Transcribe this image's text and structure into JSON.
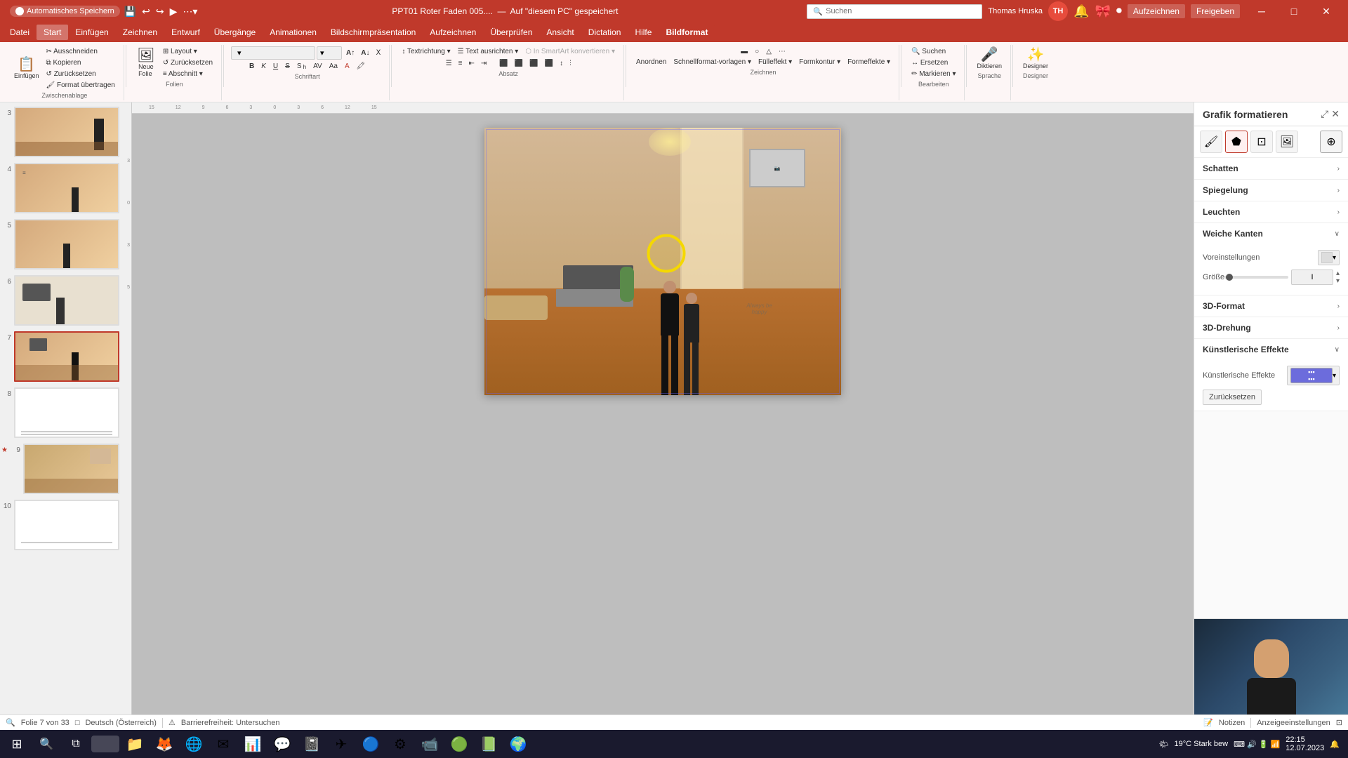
{
  "titleBar": {
    "autosave": "Automatisches Speichern",
    "title": "PPT01 Roter Faden 005....",
    "save_location": "Auf \"diesem PC\" gespeichert",
    "user": "Thomas Hruska",
    "user_initials": "TH",
    "min": "─",
    "max": "□",
    "close": "✕"
  },
  "search": {
    "placeholder": "Suchen"
  },
  "menuBar": {
    "items": [
      {
        "id": "datei",
        "label": "Datei"
      },
      {
        "id": "start",
        "label": "Start"
      },
      {
        "id": "einfuegen",
        "label": "Einfügen"
      },
      {
        "id": "zeichnen",
        "label": "Zeichnen"
      },
      {
        "id": "entwurf",
        "label": "Entwurf"
      },
      {
        "id": "uebergaenge",
        "label": "Übergänge"
      },
      {
        "id": "animationen",
        "label": "Animationen"
      },
      {
        "id": "bildschirmpraesentation",
        "label": "Bildschirmpräsentation"
      },
      {
        "id": "aufzeichnen",
        "label": "Aufzeichnen"
      },
      {
        "id": "ueberpruefen",
        "label": "Überprüfen"
      },
      {
        "id": "ansicht",
        "label": "Ansicht"
      },
      {
        "id": "dictation",
        "label": "Dictation"
      },
      {
        "id": "hilfe",
        "label": "Hilfe"
      },
      {
        "id": "bildformat",
        "label": "Bildformat"
      }
    ]
  },
  "ribbon": {
    "groups": [
      {
        "id": "zwischenablage",
        "label": "Zwischenablage",
        "buttons": [
          {
            "id": "einfuegen-btn",
            "label": "Einfügen",
            "icon": "📋"
          },
          {
            "id": "ausschneiden",
            "label": "Ausschneiden",
            "icon": "✂"
          },
          {
            "id": "kopieren",
            "label": "Kopieren",
            "icon": "⧉"
          },
          {
            "id": "zuruecksetzen",
            "label": "Zurücksetzen",
            "icon": "↺"
          },
          {
            "id": "format-uebertragen",
            "label": "Format übertragen",
            "icon": "🖌"
          }
        ]
      },
      {
        "id": "folien",
        "label": "Folien",
        "buttons": [
          {
            "id": "neue-folie",
            "label": "Neue Folie",
            "icon": "➕"
          },
          {
            "id": "layout",
            "label": "Layout",
            "icon": "⊞"
          },
          {
            "id": "zuruecksetzen2",
            "label": "Zurücksetzen",
            "icon": "↺"
          },
          {
            "id": "abschnitt",
            "label": "Abschnitt ▾",
            "icon": ""
          }
        ]
      },
      {
        "id": "schriftart",
        "label": "Schriftart",
        "buttons": [
          {
            "id": "fett",
            "label": "F",
            "icon": "𝐁"
          },
          {
            "id": "kursiv",
            "label": "K",
            "icon": "𝐼"
          },
          {
            "id": "unterstrichen",
            "label": "U",
            "icon": "U̲"
          },
          {
            "id": "durchgestrichen",
            "label": "S",
            "icon": "S̶"
          }
        ]
      },
      {
        "id": "absatz",
        "label": "Absatz",
        "buttons": []
      },
      {
        "id": "zeichnen-group",
        "label": "Zeichnen",
        "buttons": []
      },
      {
        "id": "bearbeiten",
        "label": "Bearbeiten",
        "buttons": [
          {
            "id": "suchen",
            "label": "Suchen",
            "icon": "🔍"
          },
          {
            "id": "ersetzen",
            "label": "Ersetzen",
            "icon": "↔"
          },
          {
            "id": "markieren",
            "label": "Markieren",
            "icon": "✏"
          }
        ]
      },
      {
        "id": "sprache",
        "label": "Sprache",
        "buttons": [
          {
            "id": "diktieren",
            "label": "Diktieren",
            "icon": "🎤"
          }
        ]
      },
      {
        "id": "designer-group",
        "label": "Designer",
        "buttons": [
          {
            "id": "designer",
            "label": "Designer",
            "icon": "✨"
          }
        ]
      }
    ]
  },
  "slides": [
    {
      "num": 3,
      "type": "room"
    },
    {
      "num": 4,
      "type": "person"
    },
    {
      "num": 5,
      "type": "person2"
    },
    {
      "num": 6,
      "type": "desk"
    },
    {
      "num": 7,
      "type": "room-active",
      "active": true
    },
    {
      "num": 8,
      "type": "blank"
    },
    {
      "num": 9,
      "type": "room2"
    },
    {
      "num": 10,
      "type": "blank2"
    }
  ],
  "formatPanel": {
    "title": "Grafik formatieren",
    "sections": [
      {
        "id": "schatten",
        "label": "Schatten",
        "expanded": false
      },
      {
        "id": "spiegelung",
        "label": "Spiegelung",
        "expanded": false
      },
      {
        "id": "leuchten",
        "label": "Leuchten",
        "expanded": false
      },
      {
        "id": "weiche-kanten",
        "label": "Weiche Kanten",
        "expanded": true,
        "rows": [
          {
            "label": "Voreinstellungen",
            "control": "dropdown"
          },
          {
            "label": "Größe",
            "control": "slider"
          }
        ]
      },
      {
        "id": "3d-format",
        "label": "3D-Format",
        "expanded": false
      },
      {
        "id": "3d-drehung",
        "label": "3D-Drehung",
        "expanded": false
      },
      {
        "id": "kuenstlerische-effekte",
        "label": "Künstlerische Effekte",
        "expanded": true,
        "rows": [
          {
            "label": "Künstlerische Effekte",
            "control": "effects-dropdown"
          }
        ]
      }
    ],
    "effects_button": "Zurücksetzen"
  },
  "statusBar": {
    "slide_info": "Folie 7 von 33",
    "language": "Deutsch (Österreich)",
    "accessibility": "Barrierefreiheit: Untersuchen",
    "notes": "Notizen",
    "view_settings": "Anzeigeeinstellungen"
  },
  "taskbar": {
    "time": "19°C  Stark bew",
    "start_icon": "⊞",
    "items": [
      {
        "id": "search",
        "icon": "🔍"
      },
      {
        "id": "file-explorer",
        "icon": "📁"
      },
      {
        "id": "edge",
        "icon": "🌐"
      },
      {
        "id": "chrome",
        "icon": "⬤"
      },
      {
        "id": "mail",
        "icon": "✉"
      },
      {
        "id": "ppt",
        "icon": "📊"
      },
      {
        "id": "teams",
        "icon": "💬"
      },
      {
        "id": "onenote",
        "icon": "📓"
      },
      {
        "id": "telegram",
        "icon": "✈"
      },
      {
        "id": "zoom",
        "icon": "📹"
      }
    ]
  }
}
